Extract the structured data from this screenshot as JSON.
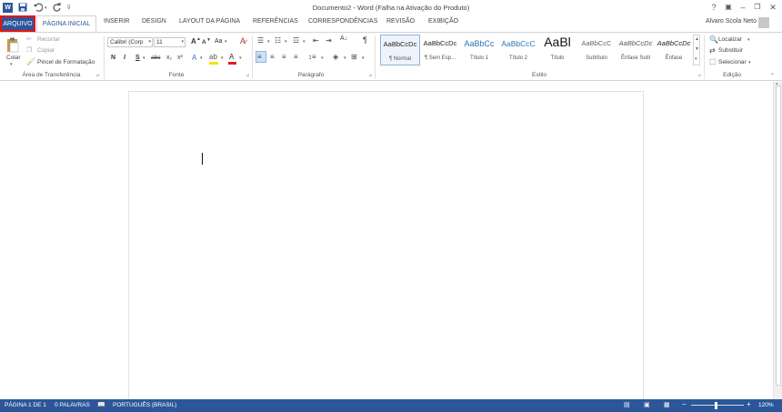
{
  "window": {
    "title": "Documento2 - Word (Falha na Ativação do Produto)",
    "user_name": "Alvaro Scola Neto",
    "help_label": "?"
  },
  "quick_access": {
    "icons": [
      "word-logo-icon",
      "save-icon",
      "undo-icon",
      "redo-icon",
      "customize-icon"
    ]
  },
  "tabs": {
    "file": "ARQUIVO",
    "home": "PÁGINA INICIAL",
    "insert": "INSERIR",
    "design": "DESIGN",
    "layout": "LAYOUT DA PÁGINA",
    "references": "REFERÊNCIAS",
    "mailings": "CORRESPONDÊNCIAS",
    "review": "REVISÃO",
    "view": "EXIBIÇÃO"
  },
  "clipboard": {
    "paste": "Colar",
    "cut": "Recortar",
    "copy": "Copiar",
    "format_painter": "Pincel de Formatação",
    "group_label": "Área de Transferência"
  },
  "font": {
    "font_name": "Calibri (Corp",
    "font_size": "11",
    "bold": "N",
    "italic": "I",
    "underline": "S",
    "strike": "abc",
    "subscript": "x₂",
    "superscript": "x²",
    "grow": "A",
    "shrink": "A",
    "case": "Aa",
    "group_label": "Fonte"
  },
  "paragraph": {
    "group_label": "Parágrafo"
  },
  "styles": {
    "items": [
      {
        "preview": "AaBbCcDc",
        "name": "¶ Normal"
      },
      {
        "preview": "AaBbCcDc",
        "name": "¶ Sem Esp..."
      },
      {
        "preview": "AaBbCc",
        "name": "Título 1"
      },
      {
        "preview": "AaBbCcC",
        "name": "Título 2"
      },
      {
        "preview": "AaBl",
        "name": "Título"
      },
      {
        "preview": "AaBbCcC",
        "name": "Subtítulo"
      },
      {
        "preview": "AaBbCcDc",
        "name": "Ênfase Sutil"
      },
      {
        "preview": "AaBbCcDc",
        "name": "Ênfase"
      }
    ],
    "group_label": "Estilo"
  },
  "editing": {
    "find": "Localizar",
    "replace": "Substituir",
    "select": "Selecionar",
    "group_label": "Edição"
  },
  "status": {
    "page": "PÁGINA 1 DE 1",
    "words": "0 PALAVRAS",
    "language": "PORTUGUÊS (BRASIL)",
    "zoom": "120%",
    "zoom_minus": "−",
    "zoom_plus": "+"
  },
  "colors": {
    "accent": "#2b579a",
    "highlight_bar": "#f5e11b",
    "font_color_bar": "#e02020",
    "file_tab_outline": "#e11111"
  }
}
